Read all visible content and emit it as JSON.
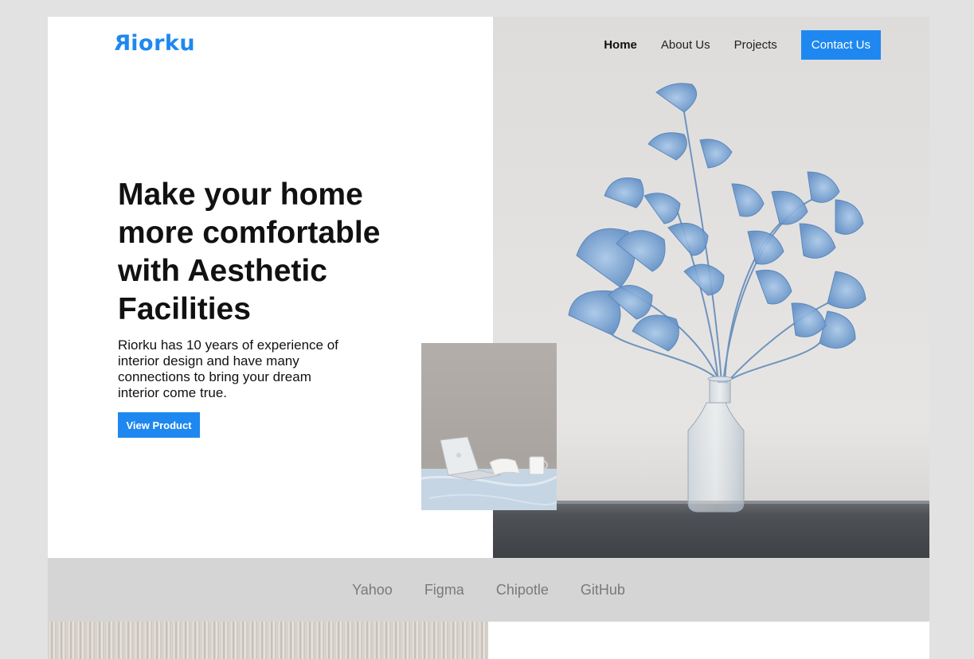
{
  "brand": {
    "logo_mark": "R",
    "logo_rest": "iorku",
    "accent_color": "#1e88f0"
  },
  "nav": {
    "items": [
      {
        "label": "Home",
        "active": true
      },
      {
        "label": "About Us",
        "active": false
      },
      {
        "label": "Projects",
        "active": false
      }
    ],
    "contact_label": "Contact Us"
  },
  "hero": {
    "headline": "Make your home more comfortable with Aesthetic Facilities",
    "lead": "Riorku has 10 years of experience of interior design and have many connections to bring your dream interior come true.",
    "cta_label": "View Product"
  },
  "partners": [
    "Yahoo",
    "Figma",
    "Chipotle",
    "GitHub"
  ]
}
